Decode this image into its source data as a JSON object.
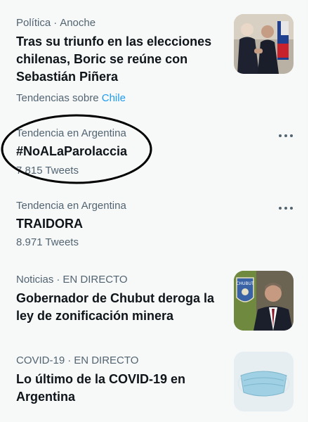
{
  "trends": [
    {
      "category": "Política",
      "when": "Anoche",
      "headline": "Tras su triunfo en las elecciones chilenas, Boric se reúne con Sebastián Piñera",
      "topic_prefix": "Tendencias sobre",
      "topic_link": "Chile"
    },
    {
      "context": "Tendencia en Argentina",
      "name": "#NoALaParolaccia",
      "count": "7.815 Tweets"
    },
    {
      "context": "Tendencia en Argentina",
      "name": "TRAIDORA",
      "count": "8.971 Tweets"
    },
    {
      "category": "Noticias",
      "when": "EN DIRECTO",
      "headline": "Gobernador de Chubut deroga la ley de zonificación minera"
    },
    {
      "category": "COVID-19",
      "when": "EN DIRECTO",
      "headline": "Lo último de la COVID-19 en Argentina"
    }
  ],
  "separator": "·",
  "colors": {
    "panel_bg": "#f7f9f9",
    "primary_text": "#0f1419",
    "secondary_text": "#536471",
    "link": "#1d9bf0"
  },
  "icons": {
    "more": "more-horizontal-icon"
  },
  "badge": "CHUBUT"
}
